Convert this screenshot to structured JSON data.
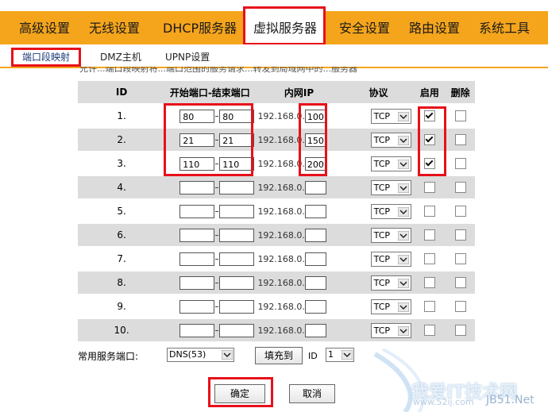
{
  "top_nav": {
    "items": [
      "高级设置",
      "无线设置",
      "DHCP服务器",
      "虚拟服务器",
      "安全设置",
      "路由设置",
      "系统工具"
    ],
    "active": "虚拟服务器"
  },
  "sub_nav": {
    "items": [
      "端口段映射",
      "DMZ主机",
      "UPNP设置"
    ],
    "active": "端口段映射"
  },
  "note": "允许...端口段映射将...端口范围的服务请求...转发到局域网中的...服务器",
  "table": {
    "headers": {
      "id": "ID",
      "port_range": "开始端口-结束端口",
      "lan_ip": "内网IP",
      "protocol": "协议",
      "enable": "启用",
      "delete": "删除"
    },
    "ip_prefix": "192.168.0.",
    "rows": [
      {
        "id": "1.",
        "start": "80",
        "end": "80",
        "ip_last": "100",
        "protocol": "TCP",
        "enabled": true,
        "delete": false
      },
      {
        "id": "2.",
        "start": "21",
        "end": "21",
        "ip_last": "150",
        "protocol": "TCP",
        "enabled": true,
        "delete": false
      },
      {
        "id": "3.",
        "start": "110",
        "end": "110",
        "ip_last": "200",
        "protocol": "TCP",
        "enabled": true,
        "delete": false
      },
      {
        "id": "4.",
        "start": "",
        "end": "",
        "ip_last": "",
        "protocol": "TCP",
        "enabled": false,
        "delete": false
      },
      {
        "id": "5.",
        "start": "",
        "end": "",
        "ip_last": "",
        "protocol": "TCP",
        "enabled": false,
        "delete": false
      },
      {
        "id": "6.",
        "start": "",
        "end": "",
        "ip_last": "",
        "protocol": "TCP",
        "enabled": false,
        "delete": false
      },
      {
        "id": "7.",
        "start": "",
        "end": "",
        "ip_last": "",
        "protocol": "TCP",
        "enabled": false,
        "delete": false
      },
      {
        "id": "8.",
        "start": "",
        "end": "",
        "ip_last": "",
        "protocol": "TCP",
        "enabled": false,
        "delete": false
      },
      {
        "id": "9.",
        "start": "",
        "end": "",
        "ip_last": "",
        "protocol": "TCP",
        "enabled": false,
        "delete": false
      },
      {
        "id": "10.",
        "start": "",
        "end": "",
        "ip_last": "",
        "protocol": "TCP",
        "enabled": false,
        "delete": false
      }
    ]
  },
  "common_ports": {
    "label": "常用服务端口:",
    "service": "DNS(53)",
    "fill_button": "填充到",
    "id_label": "ID",
    "id_value": "1"
  },
  "buttons": {
    "ok": "确定",
    "cancel": "取消"
  },
  "watermark": {
    "text": "我爱IT技术网",
    "url": "www.52ij.com",
    "net": "JB51.Net"
  },
  "colors": {
    "accent": "#f5a51c",
    "highlight": "#e8101a",
    "row_alt": "#dcdcdc"
  }
}
